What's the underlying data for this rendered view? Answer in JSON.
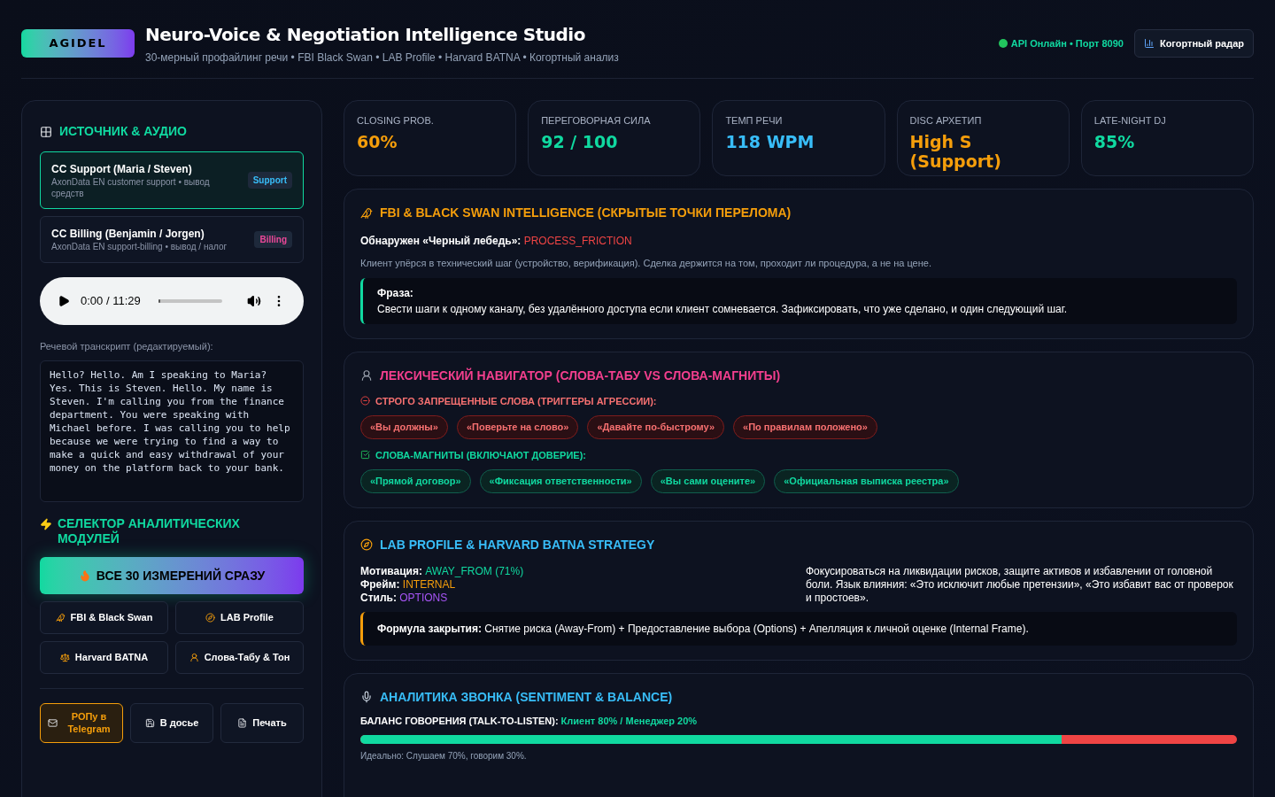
{
  "header": {
    "logo": "AGIDEL",
    "title": "Neuro-Voice & Negotiation Intelligence Studio",
    "subtitle": "30-мерный профайлинг речи • FBI Black Swan • LAB Profile • Harvard BATNA • Когортный анализ",
    "status": {
      "text": "API Онлайн • Порт 8090",
      "online": true
    },
    "radar_button": "Когортный радар"
  },
  "sidebar": {
    "source_title": "ИСТОЧНИК & АУДИО",
    "sources": [
      {
        "title": "CC Support (Maria / Steven)",
        "subtitle": "AxonData EN customer support • вывод средств",
        "tag": "Support",
        "color": "#38bdf8",
        "selected": true
      },
      {
        "title": "CC Billing (Benjamin / Jorgen)",
        "subtitle": "AxonData EN support-billing • вывод / налог",
        "tag": "Billing",
        "color": "#ec4899",
        "selected": false
      }
    ],
    "player": {
      "time": "0:00 / 11:29",
      "level": 0
    },
    "transcript_label": "Речевой транскрипт (редактируемый):",
    "transcript": "Hello? Hello. Am I speaking to Maria? Yes. This is Steven. Hello. My name is Steven. I'm calling you from the finance department. You were speaking with Michael before. I was calling you to help because we were trying to find a way to make a quick and easy withdrawal of your money on the platform back to your bank.",
    "modules_title": "СЕЛЕКТОР АНАЛИТИЧЕСКИХ МОДУЛЕЙ",
    "all_button": {
      "label": "ВСЕ 30 ИЗМЕРЕНИЙ СРАЗУ",
      "selected": true
    },
    "modules": [
      {
        "label": "FBI & Black Swan",
        "selected": false
      },
      {
        "label": "LAB Profile",
        "selected": false
      },
      {
        "label": "Harvard BATNA",
        "selected": false
      },
      {
        "label": "Слова-Табу & Тон",
        "selected": false
      }
    ],
    "actions": [
      {
        "label": "РОПу в Telegram",
        "kind": "accent"
      },
      {
        "label": "В досье",
        "kind": "plain"
      },
      {
        "label": "Печать",
        "kind": "plain"
      }
    ]
  },
  "stats": [
    {
      "label": "CLOSING PROB.",
      "value": "60%",
      "color": "#f59e0b"
    },
    {
      "label": "ПЕРЕГОВОРНАЯ СИЛА",
      "value": "92 / 100",
      "color": "#10d9a0"
    },
    {
      "label": "ТЕМП РЕЧИ",
      "value": "118 WPM",
      "color": "#38bdf8"
    },
    {
      "label": "DISC АРХЕТИП",
      "value": "High S (Support)",
      "color": "#f59e0b"
    },
    {
      "label": "LATE-NIGHT DJ",
      "value": "85%",
      "color": "#10d9a0"
    }
  ],
  "fbi": {
    "title": "FBI & BLACK SWAN INTELLIGENCE (СКРЫТЫЕ ТОЧКИ ПЕРЕЛОМА)",
    "detected_label": "Обнаружен «Черный лебедь»:",
    "detected_value": "PROCESS_FRICTION",
    "description": "Клиент упёрся в технический шаг (устройство, верификация). Сделка держится на том, проходит ли процедура, а не на цене.",
    "phrase_label": "Фраза:",
    "phrase": "Свести шаги к одному каналу, без удалённого доступа если клиент сомневается. Зафиксировать, что уже сделано, и один следующий шаг."
  },
  "lexicon": {
    "title": "ЛЕКСИЧЕСКИЙ НАВИГАТОР (СЛОВА-ТАБУ VS СЛОВА-МАГНИТЫ)",
    "groups": [
      {
        "kind": "forbidden",
        "title": "СТРОГО ЗАПРЕЩЕННЫЕ СЛОВА (ТРИГГЕРЫ АГРЕССИИ):",
        "words": [
          "«Вы должны»",
          "«Поверьте на слово»",
          "«Давайте по-быстрому»",
          "«По правилам положено»"
        ]
      },
      {
        "kind": "magnet",
        "title": "СЛОВА-МАГНИТЫ (ВКЛЮЧАЮТ ДОВЕРИЕ):",
        "words": [
          "«Прямой договор»",
          "«Фиксация ответственности»",
          "«Вы сами оцените»",
          "«Официальная выписка реестра»"
        ]
      }
    ]
  },
  "lab": {
    "title": "LAB PROFILE & HARVARD BATNA STRATEGY",
    "facts": [
      {
        "label": "Мотивация:",
        "value": "AWAY_FROM (71%)",
        "color": "#10d9a0"
      },
      {
        "label": "Фрейм:",
        "value": "INTERNAL",
        "color": "#f59e0b"
      },
      {
        "label": "Стиль:",
        "value": "OPTIONS",
        "color": "#a855f7"
      }
    ],
    "advice": "Фокусироваться на ликвидации рисков, защите активов и избавлении от головной боли. Язык влияния: «Это исключит любые претензии», «Это избавит вас от проверок и простоев».",
    "formula_label": "Формула закрытия:",
    "formula": "Снятие риска (Away-From) + Предоставление выбора (Options) + Апелляция к личной оценке (Internal Frame)."
  },
  "analytics": {
    "title": "АНАЛИТИКА ЗВОНКА (SENTIMENT & BALANCE)",
    "balance_label": "БАЛАНС ГОВОРЕНИЯ (TALK-TO-LISTEN):",
    "balance_value": "Клиент 80% / Менеджер 20%",
    "level": 0.8,
    "note": "Идеально: Слушаем 70%, говорим 30%."
  }
}
